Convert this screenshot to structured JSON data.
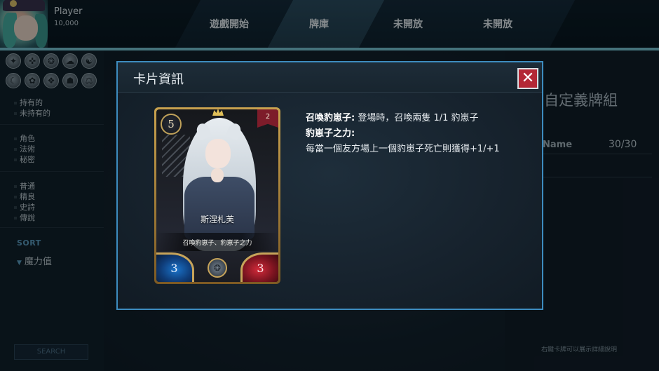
{
  "player": {
    "name": "Player",
    "gold": "10,000"
  },
  "tabs": [
    {
      "label": "遊戲開始"
    },
    {
      "label": "牌庫"
    },
    {
      "label": "未開放"
    },
    {
      "label": "未開放"
    }
  ],
  "filters": {
    "ownership": [
      "持有的",
      "未持有的"
    ],
    "types": [
      "角色",
      "法術",
      "秘密"
    ],
    "rarities": [
      "普通",
      "精良",
      "史詩",
      "傳說"
    ]
  },
  "sort": {
    "label": "SORT",
    "value": "魔力值"
  },
  "search": {
    "label": "SEARCH"
  },
  "deck": {
    "title": "自定義牌組",
    "name_label": "Name",
    "count": "30/30",
    "hint": "右鍵卡牌可以展示詳細說明"
  },
  "modal": {
    "title": "卡片資訊",
    "close": "✕",
    "card": {
      "cost": "5",
      "rarity": "2",
      "name": "斯涅札芙",
      "desc": "召喚豹崽子、豹崽子之力",
      "attack": "3",
      "health": "3"
    },
    "abilities": [
      {
        "name": "召喚豹崽子:",
        "text": " 登場時，召喚兩隻 1/1 豹崽子"
      },
      {
        "name": "豹崽子之力:",
        "text": ""
      }
    ],
    "ability_desc": "每當一個友方場上一個豹崽子死亡則獲得+1/+1"
  },
  "colors": {
    "accent": "#7cc9d8",
    "modal_border": "#3d8cbf",
    "close_bg": "#b32735",
    "sort_label": "#5e9ec4"
  }
}
